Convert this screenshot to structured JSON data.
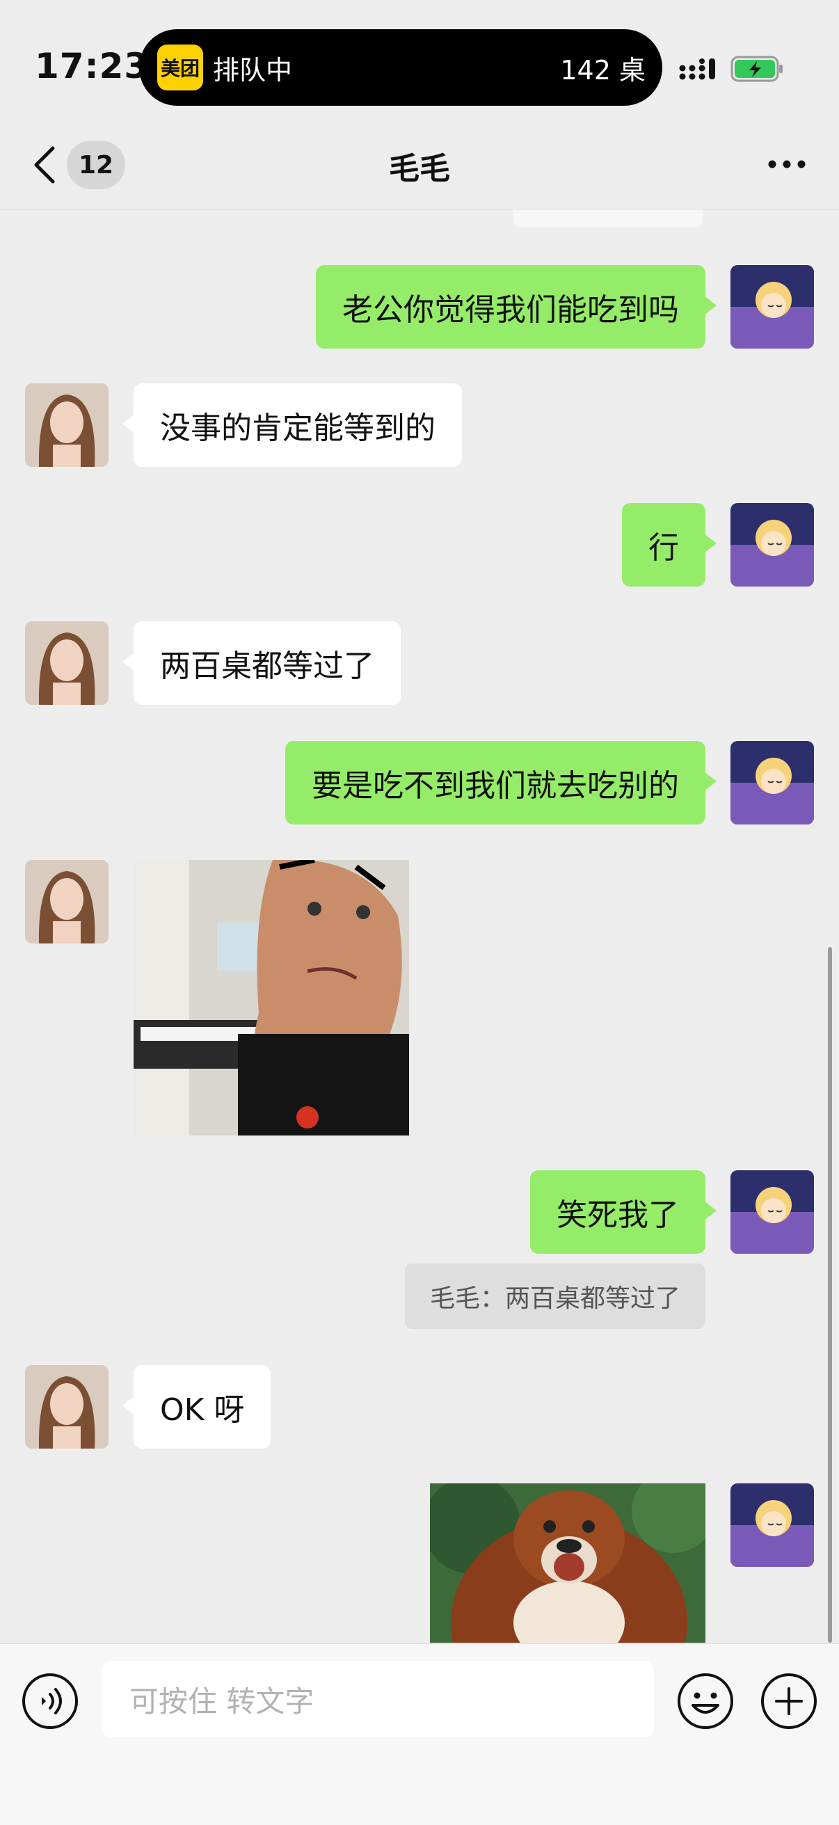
{
  "status_bar": {
    "time": "17:23",
    "island_app_logo": "美团",
    "island_status": "排队中",
    "island_queue": "142 桌"
  },
  "nav": {
    "unread_count": "12",
    "title": "毛毛"
  },
  "messages": [
    {
      "from": "me",
      "type": "text",
      "text": "老公你觉得我们能吃到吗"
    },
    {
      "from": "her",
      "type": "text",
      "text": "没事的肯定能等到的"
    },
    {
      "from": "me",
      "type": "text",
      "text": "行"
    },
    {
      "from": "her",
      "type": "text",
      "text": "两百桌都等过了"
    },
    {
      "from": "me",
      "type": "text",
      "text": "要是吃不到我们就去吃别的"
    },
    {
      "from": "her",
      "type": "image",
      "image": "meme-man-at-piano"
    },
    {
      "from": "me",
      "type": "text",
      "text": "笑死我了"
    },
    {
      "from": "me",
      "type": "quote",
      "text": "毛毛：两百桌都等过了"
    },
    {
      "from": "her",
      "type": "text",
      "text": "OK 呀"
    },
    {
      "from": "me",
      "type": "image",
      "image": "cartoon-bear-sticker"
    }
  ],
  "input_bar": {
    "placeholder": "可按住 转文字"
  },
  "colors": {
    "background": "#ededed",
    "my_bubble": "#95ec69",
    "her_bubble": "#ffffff",
    "meituan_yellow": "#ffd100",
    "battery_green": "#34c759"
  },
  "icons": [
    "back-icon",
    "more-icon",
    "voice-icon",
    "emoji-icon",
    "plus-icon",
    "signal-icon",
    "battery-icon"
  ]
}
